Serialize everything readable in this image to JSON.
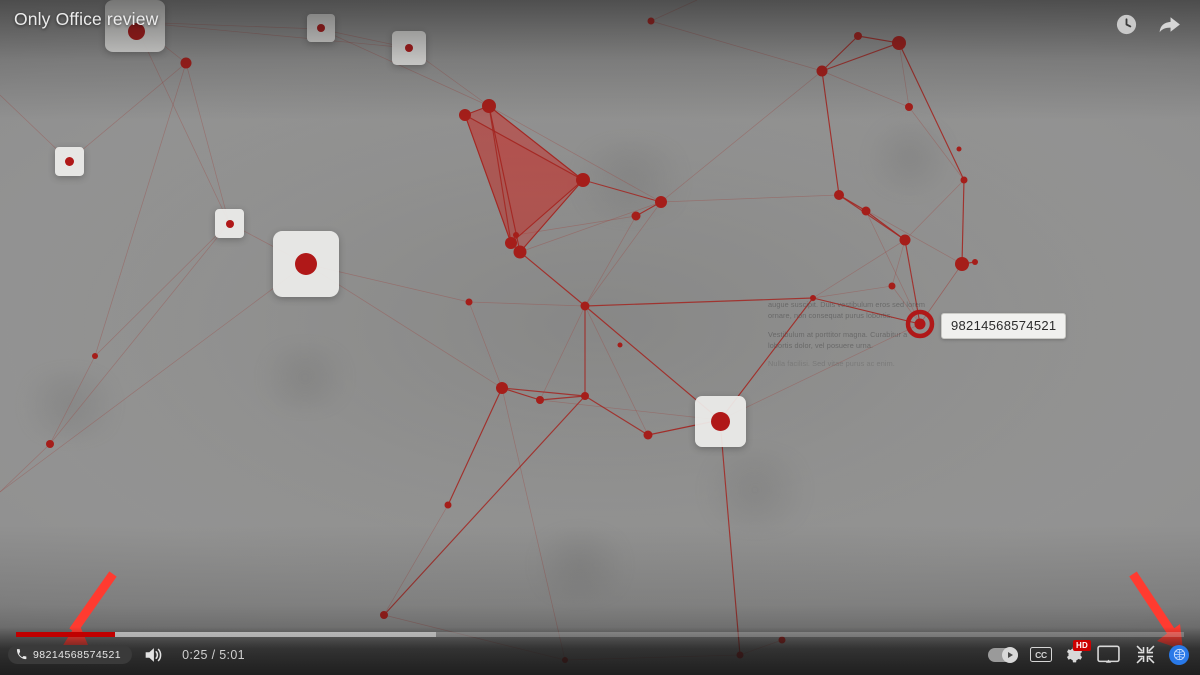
{
  "player": {
    "title": "Only Office review",
    "background_color": "#8c8c8b",
    "accent_color": "#c00000",
    "node_color": "#b01818",
    "highlight_blue": "#2979e8"
  },
  "top_actions": [
    {
      "name": "watch-later-icon",
      "label": "Watch later"
    },
    {
      "name": "share-icon",
      "label": "Share"
    }
  ],
  "progress": {
    "played_percent": 8.5,
    "buffered_percent": 36.0,
    "aria_label": "Seek slider"
  },
  "controls": {
    "phone_badge": {
      "icon": "phone-icon",
      "number": "98214568574521"
    },
    "volume_label": "Mute",
    "time_current": "0:25",
    "time_separator": "/",
    "time_total": "5:01",
    "time_display": "0:25 / 5:01",
    "autoplay_label": "Autoplay",
    "autoplay_state": "on",
    "cc_label": "CC",
    "settings_label": "Settings",
    "quality_badge": "HD",
    "miniplayer_label": "Miniplayer",
    "fullscreen_label": "Exit full screen",
    "extension_label": "Extension"
  },
  "graph": {
    "selected_node_label": "98214568574521",
    "note_paragraphs": [
      "augue suscipit. Duis vestibulum eros sed lorem ornare, non consequat purus lobortis.",
      "Vestibulum at porttitor magna. Curabitur a lobortis dolor, vel posuere urna.",
      "Nulla facilisi. Sed vitae purus ac enim."
    ]
  },
  "annotations": [
    {
      "name": "arrow-to-progress-bar",
      "color": "#ff3b30",
      "target": "progress-bar"
    },
    {
      "name": "arrow-to-extension-icon",
      "color": "#ff3b30",
      "target": "extension-icon"
    }
  ]
}
